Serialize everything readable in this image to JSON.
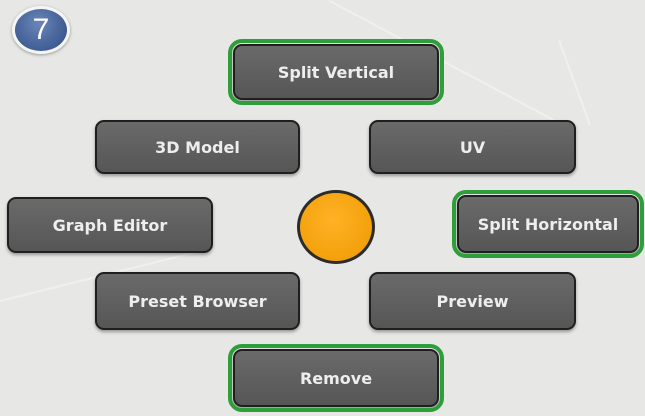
{
  "step_badge": {
    "number": "7",
    "color": "#3f5c94"
  },
  "pie_menu": {
    "highlight_color": "#2e9e3a",
    "center_color": "#f3a10b",
    "items": {
      "split_vertical": {
        "label": "Split Vertical",
        "highlighted": true
      },
      "model_3d": {
        "label": "3D Model",
        "highlighted": false
      },
      "uv": {
        "label": "UV",
        "highlighted": false
      },
      "graph_editor": {
        "label": "Graph Editor",
        "highlighted": false
      },
      "split_horizontal": {
        "label": "Split Horizontal",
        "highlighted": true
      },
      "preset_browser": {
        "label": "Preset Browser",
        "highlighted": false
      },
      "preview": {
        "label": "Preview",
        "highlighted": false
      },
      "remove": {
        "label": "Remove",
        "highlighted": true
      }
    }
  }
}
